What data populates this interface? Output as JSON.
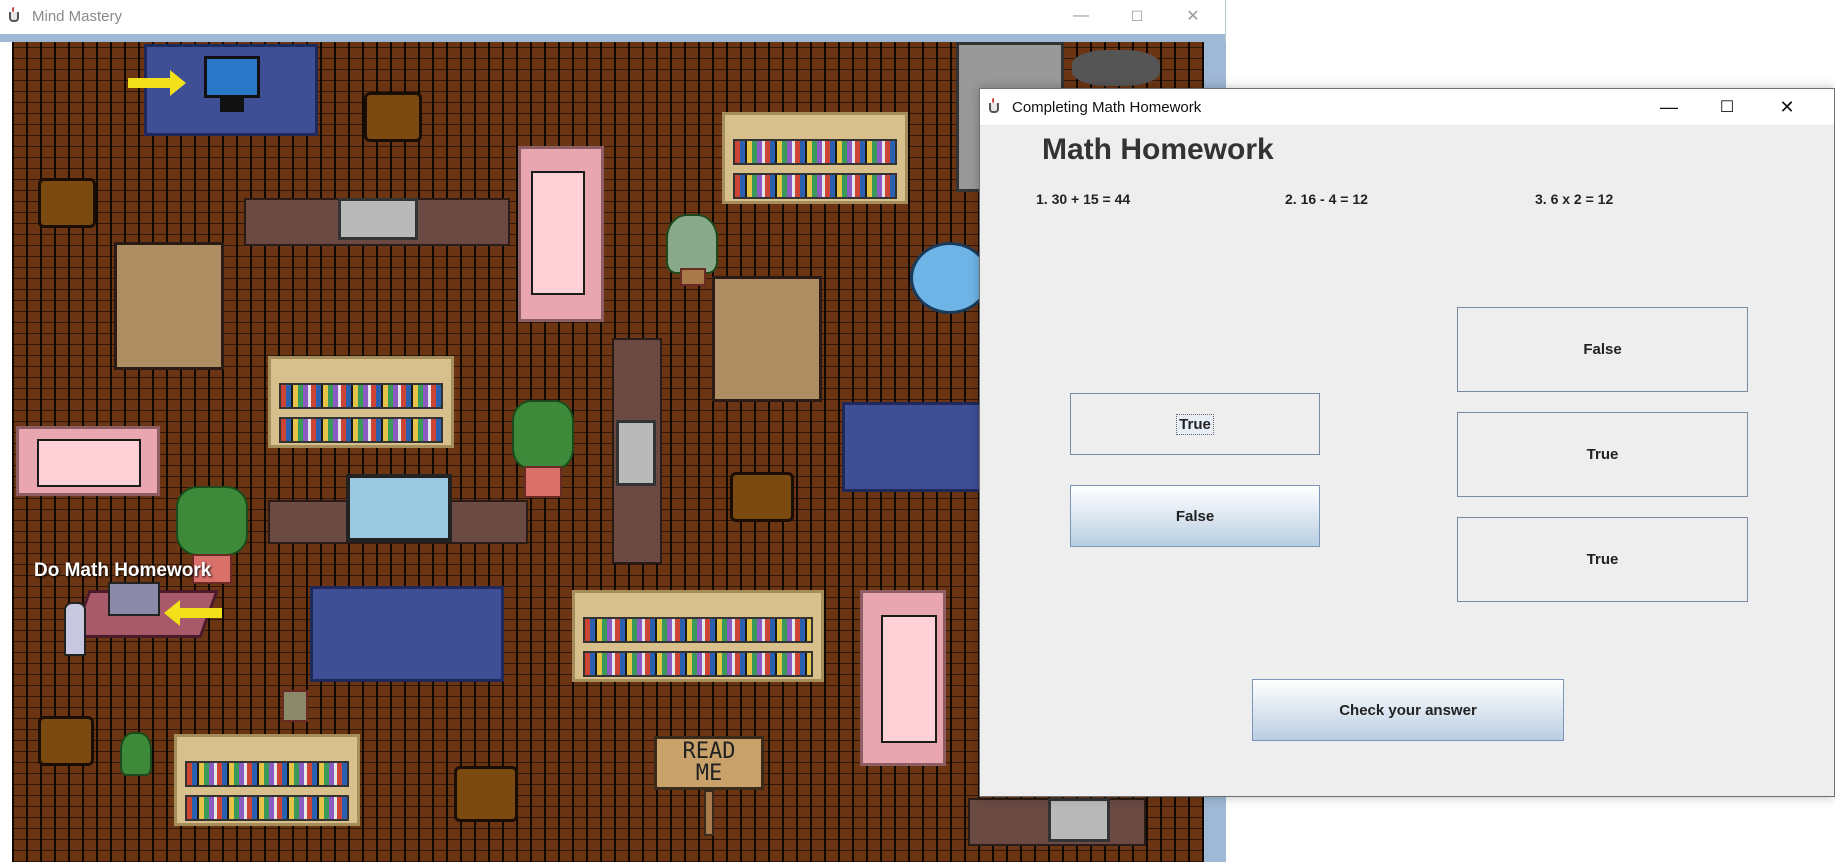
{
  "game_window": {
    "title": "Mind Mastery",
    "controls": {
      "minimize": "—",
      "maximize": "☐",
      "close": "✕"
    },
    "hint_label": "Do Math Homework",
    "sign_text": "READ\nME"
  },
  "dialog": {
    "title": "Completing Math Homework",
    "controls": {
      "minimize": "—",
      "maximize": "☐",
      "close": "✕"
    },
    "heading": "Math Homework",
    "questions": [
      "1. 30 + 15 = 44",
      "2. 16 - 4 = 12",
      "3. 6 x 2 = 12"
    ],
    "q1_buttons": {
      "true": "True",
      "false": "False"
    },
    "right_buttons": [
      "False",
      "True",
      "True"
    ],
    "check_button": "Check your answer"
  },
  "colors": {
    "floor": "#6b3514",
    "rug": "#3f4f96",
    "button_gradient_bottom": "#b8cde2",
    "arrow": "#f2e01a"
  }
}
